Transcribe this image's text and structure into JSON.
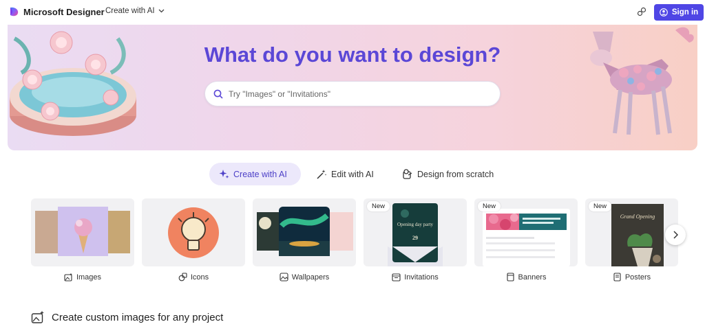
{
  "header": {
    "brand": "Microsoft Designer",
    "create_menu": "Create with AI",
    "sign_in": "Sign in"
  },
  "hero": {
    "title": "What do you want to design?",
    "search_placeholder": "Try \"Images\" or \"Invitations\""
  },
  "tabs": [
    {
      "label": "Create with AI",
      "active": true
    },
    {
      "label": "Edit with AI",
      "active": false
    },
    {
      "label": "Design from scratch",
      "active": false
    }
  ],
  "cards": [
    {
      "label": "Images",
      "new": false
    },
    {
      "label": "Icons",
      "new": false
    },
    {
      "label": "Wallpapers",
      "new": false
    },
    {
      "label": "Invitations",
      "new": true,
      "badge": "New",
      "inner_text": "Opening day party",
      "date": "29"
    },
    {
      "label": "Banners",
      "new": true,
      "badge": "New"
    },
    {
      "label": "Posters",
      "new": true,
      "badge": "New",
      "inner_text": "Grand Opening"
    }
  ],
  "section": {
    "title": "Create custom images for any project"
  },
  "colors": {
    "accent": "#4f46e5",
    "title": "#5b47d6",
    "active_tab_bg": "#ece8fb"
  }
}
